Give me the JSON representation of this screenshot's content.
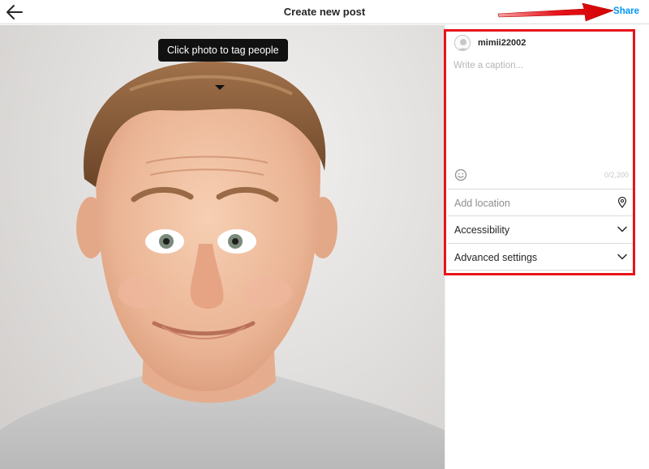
{
  "header": {
    "title": "Create new post",
    "share_label": "Share"
  },
  "photo": {
    "tag_tooltip": "Click photo to tag people"
  },
  "composer": {
    "username": "mimii22002",
    "caption_value": "",
    "caption_placeholder": "Write a caption...",
    "char_count": "0/2,200",
    "location_placeholder": "Add location",
    "accessibility_label": "Accessibility",
    "advanced_label": "Advanced settings"
  },
  "icons": [
    "back-arrow-icon",
    "emoji-icon",
    "location-pin-icon",
    "chevron-down-icon",
    "default-avatar-icon"
  ],
  "colors": {
    "share_link": "#0095f6",
    "annotation_red": "#e8141c",
    "tooltip_bg": "#111111",
    "divider": "#dbdbdb"
  }
}
